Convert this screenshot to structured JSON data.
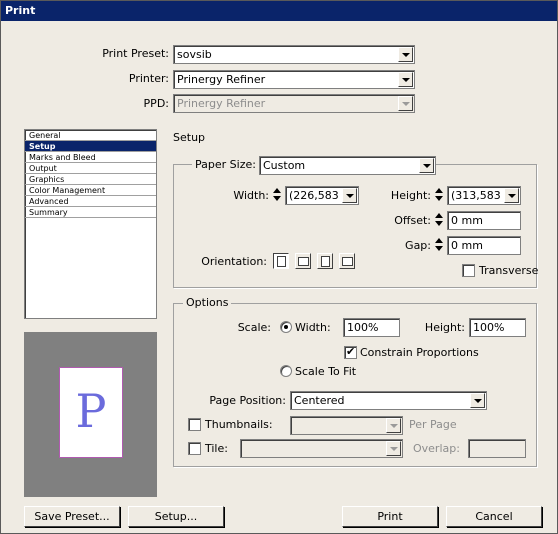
{
  "window": {
    "title": "Print"
  },
  "top": {
    "preset_label": "Print Preset:",
    "preset_value": "sovsib",
    "printer_label": "Printer:",
    "printer_value": "Prinergy Refiner",
    "ppd_label": "PPD:",
    "ppd_value": "Prinergy Refiner"
  },
  "sidebar": {
    "items": [
      {
        "label": "General",
        "selected": false
      },
      {
        "label": "Setup",
        "selected": true
      },
      {
        "label": "Marks and Bleed",
        "selected": false
      },
      {
        "label": "Output",
        "selected": false
      },
      {
        "label": "Graphics",
        "selected": false
      },
      {
        "label": "Color Management",
        "selected": false
      },
      {
        "label": "Advanced",
        "selected": false
      },
      {
        "label": "Summary",
        "selected": false
      }
    ]
  },
  "preview": {
    "page_letter": "P"
  },
  "setup": {
    "heading": "Setup",
    "paper_size_label": "Paper Size:",
    "paper_size_value": "Custom",
    "width_label": "Width:",
    "width_value": "(226,583",
    "height_label": "Height:",
    "height_value": "(313,583",
    "offset_label": "Offset:",
    "offset_value": "0 mm",
    "orientation_label": "Orientation:",
    "gap_label": "Gap:",
    "gap_value": "0 mm",
    "transverse_label": "Transverse",
    "transverse_checked": false
  },
  "options": {
    "title": "Options",
    "scale_label": "Scale:",
    "width_radio_label": "Width:",
    "width_value": "100%",
    "height_label": "Height:",
    "height_value": "100%",
    "constrain_label": "Constrain Proportions",
    "constrain_checked": true,
    "scale_to_fit_label": "Scale To Fit",
    "page_position_label": "Page Position:",
    "page_position_value": "Centered",
    "thumbnails_label": "Thumbnails:",
    "per_page_label": "Per Page",
    "tile_label": "Tile:",
    "overlap_label": "Overlap:"
  },
  "buttons": {
    "save_preset": "Save Preset...",
    "setup": "Setup...",
    "print": "Print",
    "cancel": "Cancel"
  },
  "colors": {
    "titlebar": "#0a246a",
    "selection": "#0a246a",
    "dialog_bg": "#efebe3",
    "preview_letter": "#6b6bdc"
  }
}
